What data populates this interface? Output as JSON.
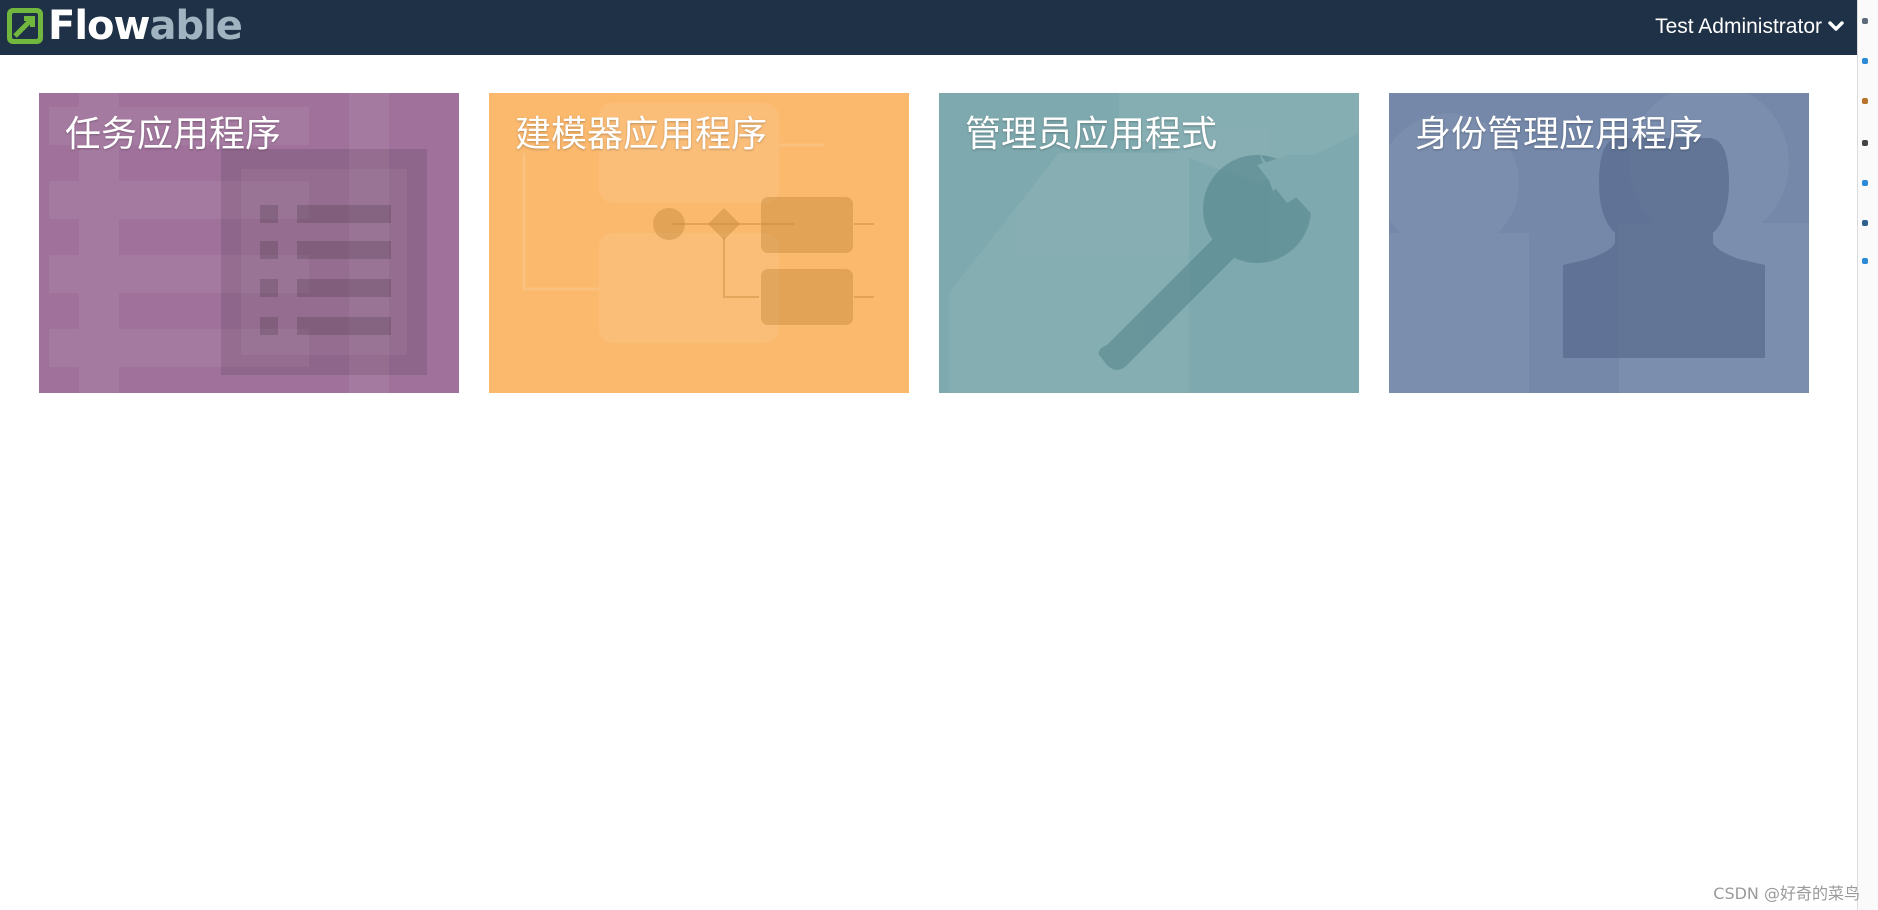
{
  "header": {
    "logo": {
      "part1": "Flow",
      "part2": "able"
    },
    "user_name": "Test Administrator",
    "colors": {
      "navbar": "#1f3146",
      "logo_green": "#72b73d"
    }
  },
  "apps": [
    {
      "title": "任务应用程序",
      "icon": "task-list-icon",
      "color": "#a0729b"
    },
    {
      "title": "建模器应用程序",
      "icon": "process-diagram-icon",
      "color": "#fbb96e"
    },
    {
      "title": "管理员应用程式",
      "icon": "wrench-icon",
      "color": "#7ea9ae"
    },
    {
      "title": "身份管理应用程序",
      "icon": "user-silhouette-icon",
      "color": "#7588aa"
    }
  ],
  "watermark": "CSDN @好奇的菜鸟"
}
